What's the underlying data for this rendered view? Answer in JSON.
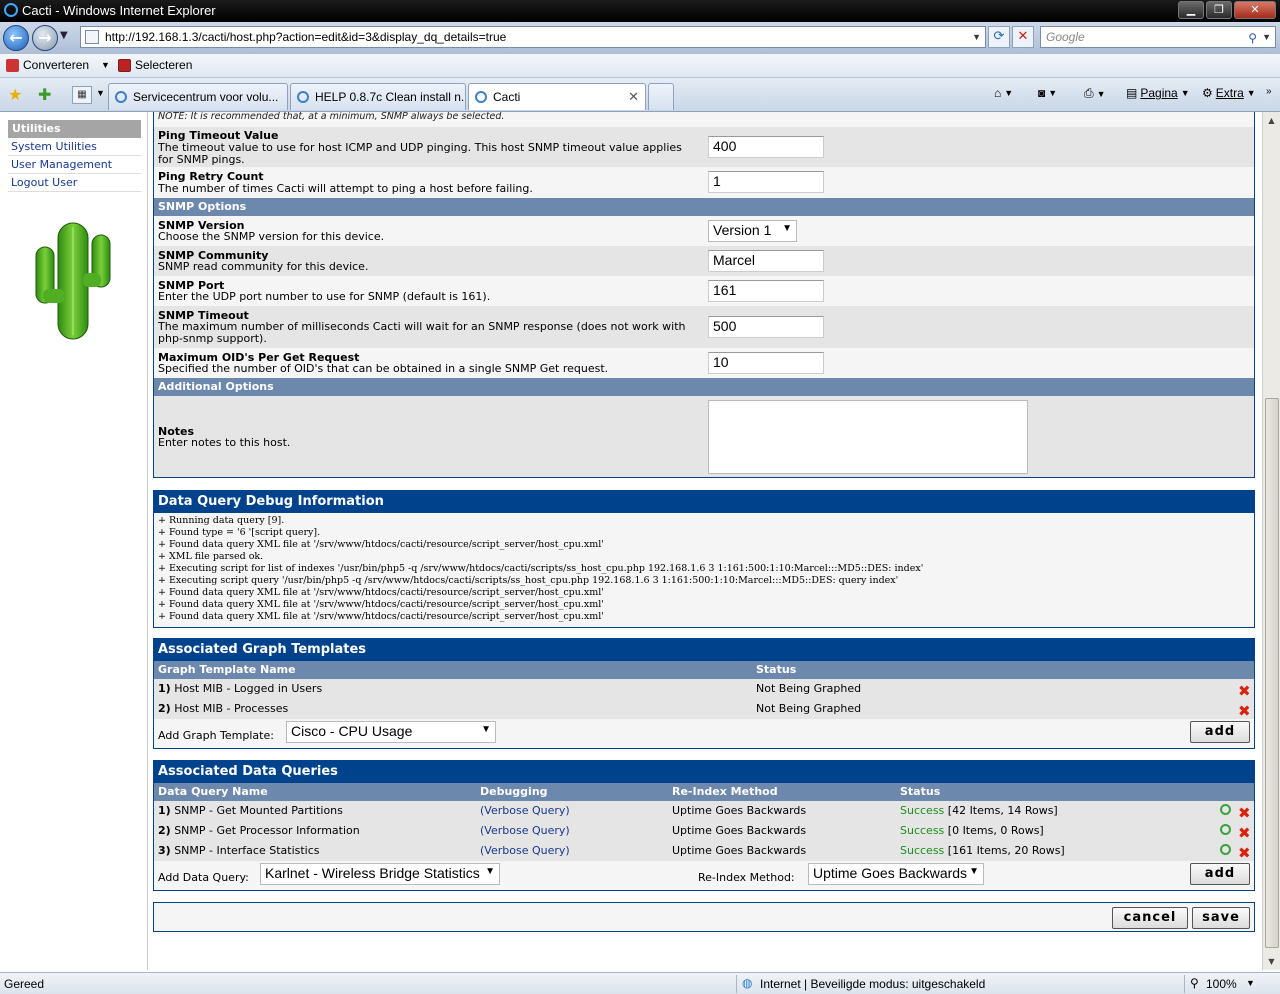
{
  "browser": {
    "title": "Cacti - Windows Internet Explorer",
    "url": "http://192.168.1.3/cacti/host.php?action=edit&id=3&display_dq_details=true",
    "search_placeholder": "Google",
    "cmd_items": [
      "Converteren",
      "Selecteren"
    ],
    "tabs": [
      {
        "label": "Servicecentrum voor volu..."
      },
      {
        "label": "HELP 0.8.7c Clean install n..."
      },
      {
        "label": "Cacti"
      }
    ],
    "tools": [
      "Pagina",
      "Extra"
    ],
    "status_left": "Gereed",
    "status_zone": "Internet | Beveiligde modus: uitgeschakeld",
    "zoom": "100%"
  },
  "sidebar": {
    "section": "Utilities",
    "links": [
      "System Utilities",
      "User Management",
      "Logout User"
    ]
  },
  "form": {
    "note": "NOTE: It is recommended that, at a minimum, SNMP always be selected.",
    "ping_timeout": {
      "label": "Ping Timeout Value",
      "desc": "The timeout value to use for host ICMP and UDP pinging. This host SNMP timeout value applies for SNMP pings.",
      "value": "400"
    },
    "ping_retry": {
      "label": "Ping Retry Count",
      "desc": "The number of times Cacti will attempt to ping a host before failing.",
      "value": "1"
    },
    "snmp_header": "SNMP Options",
    "snmp_version": {
      "label": "SNMP Version",
      "desc": "Choose the SNMP version for this device.",
      "value": "Version 1"
    },
    "snmp_community": {
      "label": "SNMP Community",
      "desc": "SNMP read community for this device.",
      "value": "Marcel"
    },
    "snmp_port": {
      "label": "SNMP Port",
      "desc": "Enter the UDP port number to use for SNMP (default is 161).",
      "value": "161"
    },
    "snmp_timeout": {
      "label": "SNMP Timeout",
      "desc": "The maximum number of milliseconds Cacti will wait for an SNMP response (does not work with php-snmp support).",
      "value": "500"
    },
    "max_oids": {
      "label": "Maximum OID's Per Get Request",
      "desc": "Specified the number of OID's that can be obtained in a single SNMP Get request.",
      "value": "10"
    },
    "additional_header": "Additional Options",
    "notes": {
      "label": "Notes",
      "desc": "Enter notes to this host.",
      "value": ""
    }
  },
  "debug": {
    "title": "Data Query Debug Information",
    "lines": [
      "+ Running data query [9].",
      "+ Found type = '6 '[script query].",
      "+ Found data query XML file at '/srv/www/htdocs/cacti/resource/script_server/host_cpu.xml'",
      "+ XML file parsed ok.",
      "+ Executing script for list of indexes '/usr/bin/php5 -q /srv/www/htdocs/cacti/scripts/ss_host_cpu.php 192.168.1.6 3 1:161:500:1:10:Marcel:::MD5::DES: index'",
      "+ Executing script query '/usr/bin/php5 -q /srv/www/htdocs/cacti/scripts/ss_host_cpu.php 192.168.1.6 3 1:161:500:1:10:Marcel:::MD5::DES: query index'",
      "+ Found data query XML file at '/srv/www/htdocs/cacti/resource/script_server/host_cpu.xml'",
      "+ Found data query XML file at '/srv/www/htdocs/cacti/resource/script_server/host_cpu.xml'",
      "+ Found data query XML file at '/srv/www/htdocs/cacti/resource/script_server/host_cpu.xml'"
    ]
  },
  "graph_templates": {
    "title": "Associated Graph Templates",
    "col_name": "Graph Template Name",
    "col_status": "Status",
    "rows": [
      {
        "num": "1)",
        "name": "Host MIB - Logged in Users",
        "status": "Not Being Graphed"
      },
      {
        "num": "2)",
        "name": "Host MIB - Processes",
        "status": "Not Being Graphed"
      }
    ],
    "add_label": "Add Graph Template:",
    "add_value": "Cisco - CPU Usage",
    "add_button": "add"
  },
  "data_queries": {
    "title": "Associated Data Queries",
    "col_name": "Data Query Name",
    "col_debug": "Debugging",
    "col_reindex": "Re-Index Method",
    "col_status": "Status",
    "rows": [
      {
        "num": "1)",
        "name": "SNMP - Get Mounted Partitions",
        "debug": "Verbose Query",
        "reindex": "Uptime Goes Backwards",
        "status": "Success",
        "detail": "[42 Items, 14 Rows]"
      },
      {
        "num": "2)",
        "name": "SNMP - Get Processor Information",
        "debug": "Verbose Query",
        "reindex": "Uptime Goes Backwards",
        "status": "Success",
        "detail": "[0 Items, 0 Rows]"
      },
      {
        "num": "3)",
        "name": "SNMP - Interface Statistics",
        "debug": "Verbose Query",
        "reindex": "Uptime Goes Backwards",
        "status": "Success",
        "detail": "[161 Items, 20 Rows]"
      }
    ],
    "add_label": "Add Data Query:",
    "add_value": "Karlnet - Wireless Bridge Statistics",
    "reindex_label": "Re-Index Method:",
    "reindex_value": "Uptime Goes Backwards",
    "add_button": "add"
  },
  "actions": {
    "cancel": "cancel",
    "save": "save"
  }
}
